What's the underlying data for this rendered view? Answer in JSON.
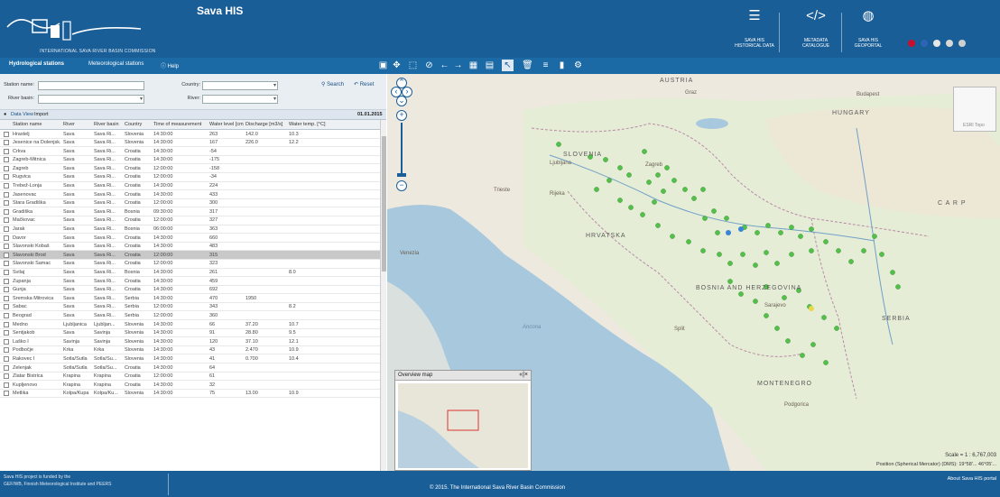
{
  "header": {
    "app_title": "Sava HIS",
    "logo_caption": "INTERNATIONAL SAVA RIVER BASIN COMMISSION",
    "links": [
      {
        "line1": "SAVA HIS",
        "line2": "HISTORICAL DATA",
        "icon": "list-icon"
      },
      {
        "line1": "METADATA",
        "line2": "CATALOGUE",
        "icon": "code-icon"
      },
      {
        "line1": "SAVA HIS",
        "line2": "GEOPORTAL",
        "icon": "globe-icon"
      }
    ],
    "flag_colors": [
      "#c8102e",
      "#2b63b5",
      "#e6e6e6",
      "#d8d8d8",
      "#cfcfcf"
    ]
  },
  "topbar": {
    "tabs": [
      "Hydrological stations",
      "Meteorological stations",
      "Help"
    ],
    "help_icon": "question-icon"
  },
  "filters": {
    "station_name_label": "Station name:",
    "river_basin_label": "River basin:",
    "country_label": "Country:",
    "river_label": "River:",
    "search_label": "Search",
    "reset_label": "Reset"
  },
  "dataview": {
    "label": "Data View",
    "mode": "Import",
    "date": "01.01.2015"
  },
  "table": {
    "columns": [
      "Station name",
      "River",
      "River basin",
      "Country",
      "Time of measurement",
      "Water level [cm]",
      "Discharge [m3/s]",
      "Water temp. [°C]"
    ],
    "rows": [
      [
        "Hrastelj",
        "Sava",
        "Sava Ri...",
        "Slovenia",
        "14:30:00",
        "263",
        "142.0",
        "10.3"
      ],
      [
        "Jesenice na Dolenjsk...",
        "Sava",
        "Sava Ri...",
        "Slovenia",
        "14:30:00",
        "167",
        "226.0",
        "12.2"
      ],
      [
        "Crkva",
        "Sava",
        "Sava Ri...",
        "Croatia",
        "14:30:00",
        "-54",
        "",
        ""
      ],
      [
        "Zagreb-Mitnica",
        "Sava",
        "Sava Ri...",
        "Croatia",
        "14:30:00",
        "-175",
        "",
        ""
      ],
      [
        "Zagreb",
        "Sava",
        "Sava Ri...",
        "Croatia",
        "12:00:00",
        "-158",
        "",
        ""
      ],
      [
        "Rugvica",
        "Sava",
        "Sava Ri...",
        "Croatia",
        "12:00:00",
        "-34",
        "",
        ""
      ],
      [
        "Trebež-Lonja",
        "Sava",
        "Sava Ri...",
        "Croatia",
        "14:30:00",
        "224",
        "",
        ""
      ],
      [
        "Jasenovac",
        "Sava",
        "Sava Ri...",
        "Croatia",
        "14:30:00",
        "433",
        "",
        ""
      ],
      [
        "Stara Gradiška",
        "Sava",
        "Sava Ri...",
        "Croatia",
        "12:00:00",
        "300",
        "",
        ""
      ],
      [
        "Gradiška",
        "Sava",
        "Sava Ri...",
        "Bosnia",
        "09:30:00",
        "317",
        "",
        ""
      ],
      [
        "Mačkovac",
        "Sava",
        "Sava Ri...",
        "Croatia",
        "12:00:00",
        "327",
        "",
        ""
      ],
      [
        "Jarak",
        "Sava",
        "Sava Ri...",
        "Bosnia",
        "06:00:00",
        "363",
        "",
        ""
      ],
      [
        "Davor",
        "Sava",
        "Sava Ri...",
        "Croatia",
        "14:30:00",
        "660",
        "",
        ""
      ],
      [
        "Slavonski Kobaš",
        "Sava",
        "Sava Ri...",
        "Croatia",
        "14:30:00",
        "483",
        "",
        ""
      ],
      [
        "Slavonski Brod",
        "Sava",
        "Sava Ri...",
        "Croatia",
        "12:00:00",
        "315",
        "",
        ""
      ],
      [
        "Slavonski Šamac",
        "Sava",
        "Sava Ri...",
        "Croatia",
        "12:00:00",
        "323",
        "",
        ""
      ],
      [
        "Svilaj",
        "Sava",
        "Sava Ri...",
        "Bosnia",
        "14:30:00",
        "261",
        "",
        "8.0"
      ],
      [
        "Županja",
        "Sava",
        "Sava Ri...",
        "Croatia",
        "14:30:00",
        "459",
        "",
        ""
      ],
      [
        "Gunja",
        "Sava",
        "Sava Ri...",
        "Croatia",
        "14:30:00",
        "692",
        "",
        ""
      ],
      [
        "Sremska Mitrovica",
        "Sava",
        "Sava Ri...",
        "Serbia",
        "14:30:00",
        "470",
        "1950",
        ""
      ],
      [
        "Šabac",
        "Sava",
        "Sava Ri...",
        "Serbia",
        "12:00:00",
        "343",
        "",
        "8.2"
      ],
      [
        "Beograd",
        "Sava",
        "Sava Ri...",
        "Serbia",
        "12:00:00",
        "360",
        "",
        ""
      ],
      [
        "Medno",
        "Ljubljanica",
        "Ljubljan...",
        "Slovenia",
        "14:30:00",
        "66",
        "37.20",
        "10.7"
      ],
      [
        "Šentjakob",
        "Sava",
        "Savinja",
        "Slovenia",
        "14:30:00",
        "91",
        "28.80",
        "9.5"
      ],
      [
        "Laško I",
        "Savinja",
        "Savinja",
        "Slovenia",
        "14:30:00",
        "120",
        "37.10",
        "12.1"
      ],
      [
        "Podbočje",
        "Krka",
        "Krka",
        "Slovenia",
        "14:30:00",
        "43",
        "2.470",
        "10.9"
      ],
      [
        "Rakovec I",
        "Sotla/Sutla",
        "Sotla/Su...",
        "Slovenia",
        "14:30:00",
        "41",
        "0.700",
        "10.4"
      ],
      [
        "Zelenjak",
        "Sotla/Sutla",
        "Sotla/Su...",
        "Croatia",
        "14:30:00",
        "64",
        "",
        ""
      ],
      [
        "Zlatar Bistrica",
        "Krapina",
        "Krapina",
        "Croatia",
        "12:00:00",
        "61",
        "",
        ""
      ],
      [
        "Kupljenovo",
        "Krapina",
        "Krapina",
        "Croatia",
        "14:30:00",
        "32",
        "",
        ""
      ],
      [
        "Metlika",
        "Kolpa/Kupa",
        "Kolpa/Ku...",
        "Slovenia",
        "14:30:00",
        "75",
        "13.00",
        "10.9"
      ]
    ],
    "selected_index": 14
  },
  "map": {
    "labels": {
      "austria": "AUSTRIA",
      "hungary": "HUNGARY",
      "slovenia": "SLOVENIA",
      "bih": "BOSNIA AND HERZEGOVINA",
      "serbia": "SERBIA",
      "montenegro": "MONTENEGRO",
      "croatia": "HRVATSKA",
      "ljubljana": "Ljubljana",
      "zagreb": "Zagreb",
      "budapest": "Budapest",
      "belgrade": "Beograd",
      "sarajevo": "Sarajevo",
      "split": "Split",
      "venezia": "Venezia",
      "rijeka": "Rijeka",
      "podgorica": "Podgorica",
      "trieste": "Trieste",
      "graz": "Graz",
      "ancona": "Ancona",
      "karpathos": "C A R P"
    },
    "overview_title": "Overview map",
    "overview_close": "«|×",
    "scale_text": "Scale = 1 : 6,767,003",
    "attribution": "Position (Spherical Mercator) (DMS): 19°58'... 46°05'...",
    "thumb_label": "ESRI Topo"
  },
  "footer": {
    "line1": "Sava HIS project is funded by the",
    "line2": "GEF/WB, Finnish Meteorological Institute and PEERS",
    "copyright": "© 2015. The International Sava River Basin Commission",
    "about": "About Sava HIS portal"
  }
}
